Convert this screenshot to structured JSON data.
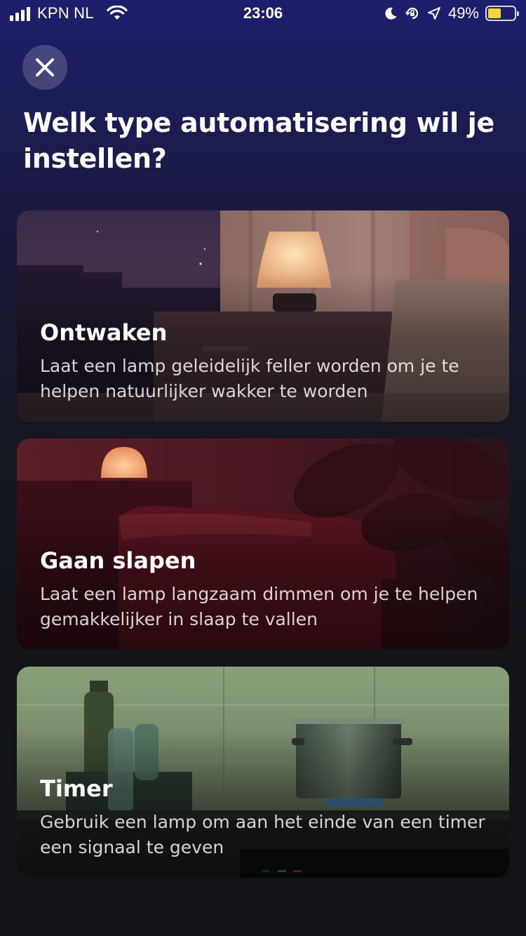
{
  "status_bar": {
    "carrier": "KPN NL",
    "time": "23:06",
    "battery_percent": "49%",
    "battery_level": 0.49,
    "icons": [
      "signal-icon",
      "wifi-icon",
      "moon-icon",
      "orientation-lock-icon",
      "location-icon",
      "battery-icon"
    ]
  },
  "header": {
    "close_icon": "close-icon",
    "title": "Welk type automatisering wil je instellen?"
  },
  "cards": [
    {
      "title": "Ontwaken",
      "description": "Laat een lamp geleidelijk feller worden om je te helpen natuurlijker wakker te worden"
    },
    {
      "title": "Gaan slapen",
      "description": "Laat een lamp langzaam dimmen om je te helpen gemakkelijker in slaap te vallen"
    },
    {
      "title": "Timer",
      "description": "Gebruik een lamp om aan het einde van een timer een signaal te geven"
    }
  ],
  "colors": {
    "background_top": "#1d1f6e",
    "background_bottom": "#111316",
    "battery_fill": "#f5d63b"
  }
}
